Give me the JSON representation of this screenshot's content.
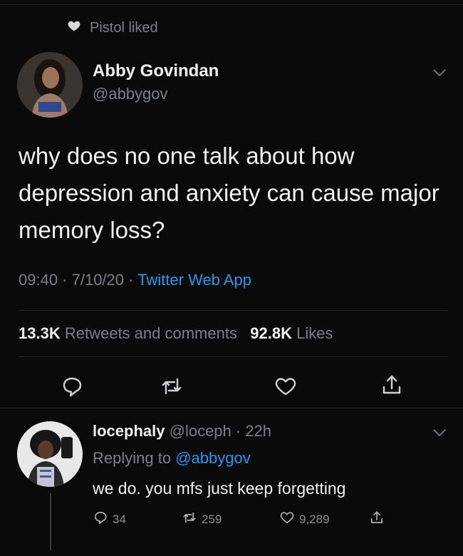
{
  "social_context": {
    "text": "Pistol liked"
  },
  "tweet": {
    "author_name": "Abby Govindan",
    "author_handle": "@abbygov",
    "text": "why does no one talk about how depression and anxiety can cause major memory loss?",
    "time_date": "09:40 · 7/10/20 ·",
    "source": "Twitter Web App",
    "retweets_count": "13.3K",
    "retweets_label": "Retweets and comments",
    "likes_count": "92.8K",
    "likes_label": "Likes"
  },
  "reply": {
    "author_name": "locephaly",
    "author_handle_time": "@loceph · 22h",
    "replying_prefix": "Replying to",
    "replying_to": "@abbygov",
    "text": "we do. you mfs just keep forgetting",
    "reply_count": "34",
    "retweet_count": "259",
    "like_count": "9,289"
  },
  "colors": {
    "background": "#0a0a0a",
    "link": "#1d9bf0",
    "muted": "#7b8086"
  },
  "icons": [
    "heart-icon",
    "chevron-down-icon",
    "reply-icon",
    "retweet-icon",
    "like-icon",
    "share-icon"
  ]
}
